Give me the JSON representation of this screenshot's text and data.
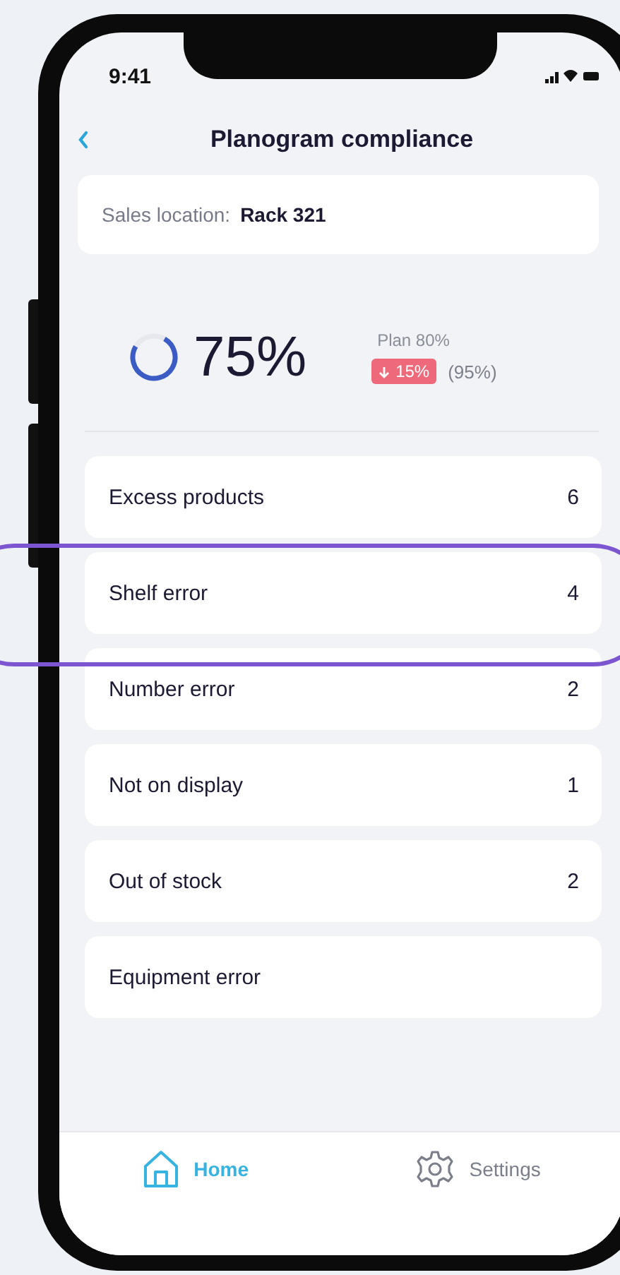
{
  "status_bar": {
    "time": "9:41"
  },
  "header": {
    "title": "Planogram compliance"
  },
  "location": {
    "label": "Sales location:",
    "value": "Rack 321"
  },
  "compliance": {
    "level": 0.75,
    "value": "75%",
    "plan": "Plan 80%",
    "trend": {
      "kind": "down",
      "text": "15%"
    },
    "previous": "(95%)"
  },
  "issues": [
    {
      "label": "Excess products",
      "count": "6",
      "highlighted": false
    },
    {
      "label": "Shelf error",
      "count": "4",
      "highlighted": true
    },
    {
      "label": "Number error",
      "count": "2",
      "highlighted": false
    },
    {
      "label": "Not on display",
      "count": "1",
      "highlighted": false
    },
    {
      "label": "Out of stock",
      "count": "2",
      "highlighted": false
    },
    {
      "label": "Equipment error",
      "highlighted": false
    }
  ],
  "tab_bar": [
    {
      "kind": "home",
      "label": "Home",
      "selected": true
    },
    {
      "kind": "settings",
      "label": "Settings",
      "selected": false
    }
  ]
}
